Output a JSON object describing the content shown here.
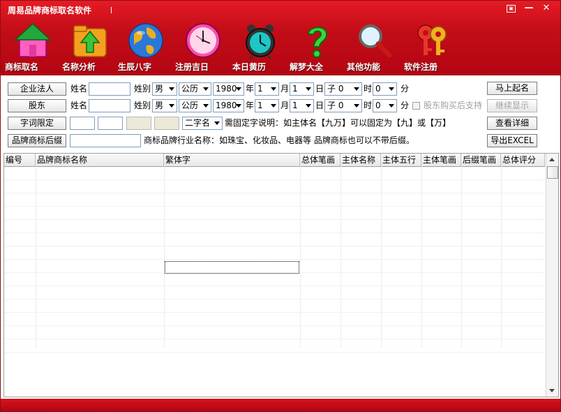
{
  "window": {
    "title": "周易品牌商标取名软件",
    "controls": {
      "menu": "▣",
      "minimize": "—",
      "close": "✕"
    }
  },
  "nav": [
    {
      "label": "商标取名",
      "icon": "home-icon"
    },
    {
      "label": "名称分析",
      "icon": "upload-folder-icon"
    },
    {
      "label": "生辰八字",
      "icon": "globe-icon"
    },
    {
      "label": "注册吉日",
      "icon": "clock-icon"
    },
    {
      "label": "本日黄历",
      "icon": "alarm-clock-icon"
    },
    {
      "label": "解梦大全",
      "icon": "question-mark-icon"
    },
    {
      "label": "其他功能",
      "icon": "magnifier-icon"
    },
    {
      "label": "软件注册",
      "icon": "keys-icon"
    }
  ],
  "form": {
    "row1": {
      "button": "企业法人",
      "name_label": "姓名",
      "gender_label": "姓别",
      "gender": "男",
      "calendar": "公历",
      "year": "1980",
      "year_unit": "年",
      "month": "1",
      "month_unit": "月",
      "day": "1",
      "day_unit": "日",
      "hour": "子 0",
      "hour_unit": "时",
      "minute": "0",
      "minute_unit": "分",
      "action": "马上起名"
    },
    "row2": {
      "button": "股东",
      "name_label": "姓名",
      "gender_label": "姓别",
      "gender": "男",
      "calendar": "公历",
      "year": "1980",
      "year_unit": "年",
      "month": "1",
      "month_unit": "月",
      "day": "1",
      "day_unit": "日",
      "hour": "子 0",
      "hour_unit": "时",
      "minute": "0",
      "minute_unit": "分",
      "checkbox_label": "股东购买后支持",
      "action": "继续显示"
    },
    "row3": {
      "button": "字词限定",
      "word_count": "二字名",
      "note": "需固定字说明：如主体名【九万】可以固定为【九】或【万】",
      "action": "查看详细"
    },
    "row4": {
      "button": "品牌商标后缀",
      "note": "商标品牌行业名称：如珠宝、化妆品、电器等  品牌商标也可以不带后缀。",
      "action": "导出EXCEL"
    }
  },
  "table": {
    "columns": [
      "编号",
      "品牌商标名称",
      "繁体字",
      "总体笔画",
      "主体名称",
      "主体五行",
      "主体笔画",
      "后缀笔画",
      "总体评分"
    ]
  },
  "colors": {
    "header_red": "#c30d18",
    "accent_dark": "#8a0f16"
  }
}
